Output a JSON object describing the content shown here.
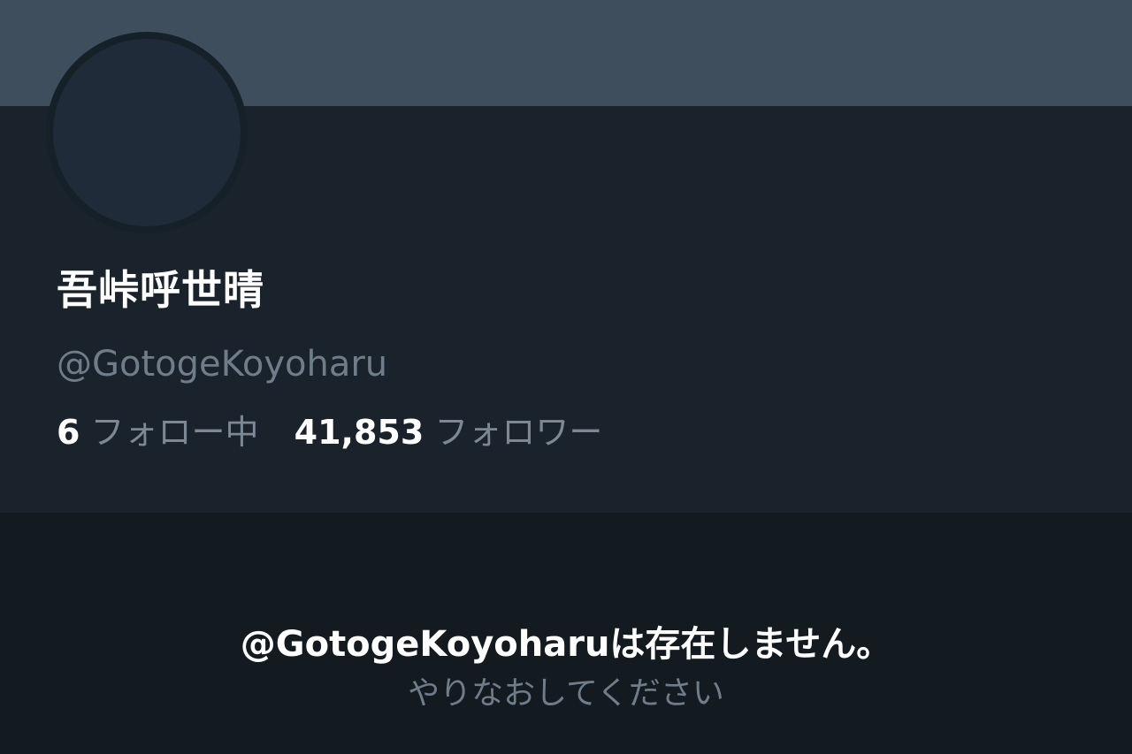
{
  "profile": {
    "display_name": "吾峠呼世晴",
    "handle": "@GotogeKoyoharu",
    "following_count": "6",
    "following_label": "フォロー中",
    "followers_count": "41,853",
    "followers_label": "フォロワー"
  },
  "error": {
    "title": "@GotogeKoyoharuは存在しません。",
    "subtitle": "やりなおしてください"
  },
  "colors": {
    "banner": "#3f4e5c",
    "panel": "#1a222b",
    "background": "#131a20",
    "text_primary": "#ffffff",
    "text_secondary": "#6f7d8a"
  }
}
